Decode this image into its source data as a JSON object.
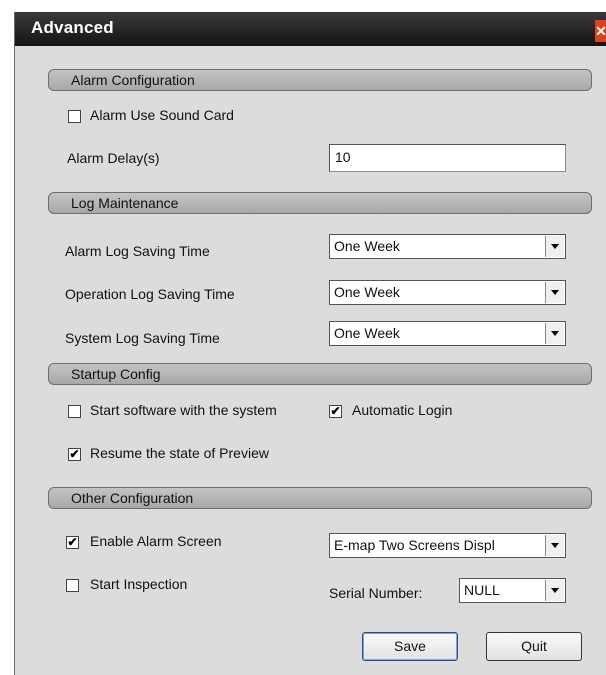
{
  "window": {
    "title": "Advanced",
    "close_glyph": "✕"
  },
  "alarm_config": {
    "header": "Alarm Configuration",
    "use_sound_card_label": "Alarm Use Sound Card",
    "use_sound_card_checked": false,
    "delay_label": "Alarm Delay(s)",
    "delay_value": "10"
  },
  "log_maintenance": {
    "header": "Log Maintenance",
    "alarm_log_label": "Alarm Log Saving Time",
    "alarm_log_value": "One Week",
    "operation_log_label": "Operation Log Saving Time",
    "operation_log_value": "One Week",
    "system_log_label": "System Log Saving Time",
    "system_log_value": "One Week"
  },
  "startup_config": {
    "header": "Startup Config",
    "start_with_system_label": "Start software with the system",
    "start_with_system_checked": false,
    "auto_login_label": "Automatic Login",
    "auto_login_checked": true,
    "resume_preview_label": "Resume the state of Preview",
    "resume_preview_checked": true
  },
  "other_config": {
    "header": "Other Configuration",
    "enable_alarm_screen_label": "Enable Alarm Screen",
    "enable_alarm_screen_checked": true,
    "alarm_screen_mode_value": "E-map Two Screens Displ",
    "start_inspection_label": "Start Inspection",
    "start_inspection_checked": false,
    "serial_number_label": "Serial Number:",
    "serial_number_value": "NULL"
  },
  "buttons": {
    "save": "Save",
    "quit": "Quit"
  },
  "check_glyph": "✔",
  "colors": {
    "close_button": "#e0401e",
    "title_bar": "#1e1e1e",
    "dialog_bg": "#dcdcdc"
  }
}
